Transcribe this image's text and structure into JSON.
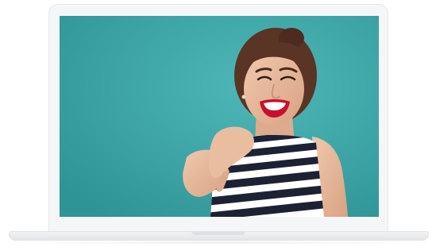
{
  "device": {
    "type": "laptop",
    "screen_image": "woman-pointing-photo"
  },
  "colors": {
    "screen_background": "#3fa6a8",
    "lid": "#f5f6f8",
    "base": "#e4e5e8",
    "stripe_dark": "#1c2233",
    "stripe_light": "#ffffff",
    "lips": "#c8102e",
    "hair": "#5a3424",
    "skin": "#e6b89a"
  }
}
